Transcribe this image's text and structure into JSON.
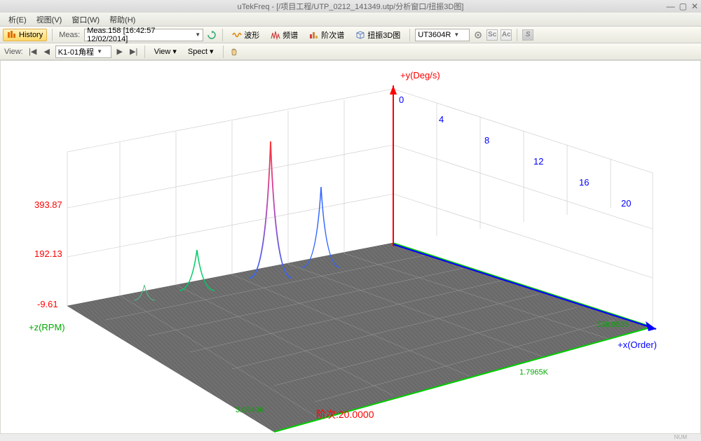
{
  "title": "uTekFreq - [/项目工程/UTP_0212_141349.utp/分析窗口/扭振3D图]",
  "menu": {
    "m1": "析(E)",
    "m2": "视图(V)",
    "m3": "窗口(W)",
    "m4": "帮助(H)"
  },
  "tb1": {
    "history": "History",
    "meas_lbl": "Meas:",
    "meas_val": "Meas.158 [16:42:57 12/02/2014]",
    "b_wave": "波形",
    "b_spec": "频谱",
    "b_order": "阶次谱",
    "b_3d": "扭振3D图",
    "dd2": "UT3604R",
    "sq_sc": "Sc",
    "sq_ac": "Ac",
    "sq_s": "S"
  },
  "tb2": {
    "view_lbl": "View:",
    "combo": "K1-01角程",
    "view_btn": "View",
    "spect_btn": "Spect"
  },
  "chart_data": {
    "type": "3d-spectrum",
    "axes": {
      "x": {
        "label": "+x(Order)",
        "ticks": [
          0.0,
          4.0,
          8.0,
          12.0,
          16.0,
          20.0
        ],
        "max_mark": "538.9535"
      },
      "y": {
        "label": "+y(Deg/s)",
        "ticks": [
          -9.61,
          192.13,
          393.87
        ]
      },
      "z": {
        "label": "+z(RPM)",
        "ticks": [
          "1.7965K",
          "3.0540K"
        ]
      }
    },
    "annotation": "阶次:20.0000",
    "peaks": [
      {
        "pos": 0.18,
        "height": 0.45,
        "color": "#00cc66"
      },
      {
        "pos": 0.3,
        "height": 0.95,
        "color_grad": [
          "#ff3333",
          "#3366ff"
        ]
      },
      {
        "pos": 0.4,
        "height": 0.6,
        "color": "#3366ff"
      }
    ]
  },
  "status": {
    "num": "NUM"
  }
}
